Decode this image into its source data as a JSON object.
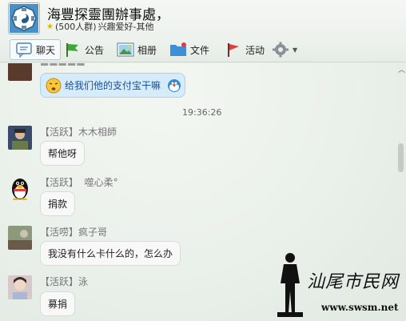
{
  "header": {
    "group_name": "海豐探靈團辦事處，",
    "member_count": "(500人群)",
    "category": "兴趣爱好-其他"
  },
  "toolbar": {
    "items": [
      {
        "label": "聊天",
        "icon": "chat-icon"
      },
      {
        "label": "公告",
        "icon": "flag-icon"
      },
      {
        "label": "相册",
        "icon": "photo-icon"
      },
      {
        "label": "文件",
        "icon": "folder-icon"
      },
      {
        "label": "活动",
        "icon": "red-flag-icon"
      },
      {
        "label": "",
        "icon": "gear-icon"
      }
    ]
  },
  "chat": {
    "top_message": {
      "text": "给我们他的支付宝干嘛"
    },
    "timestamp": "19:36:26",
    "messages": [
      {
        "tag": "【活跃】",
        "name": "木木相師",
        "text": "帮他呀"
      },
      {
        "tag": "【活跃】",
        "name": "噬心柔°",
        "text": "捐款"
      },
      {
        "tag": "【活唠】",
        "name": "疯子哥",
        "text": "我没有什么卡什么的，怎么办"
      },
      {
        "tag": "【活跃】",
        "name": "泳",
        "text": "募捐"
      }
    ]
  },
  "watermark": {
    "text": "汕尾市民网",
    "url": "www.swsm.net"
  },
  "colors": {
    "accent_blue": "#2a6fd6",
    "bubble_blue": "#d6ecfb",
    "active_flag_red": "#e23c3c"
  }
}
